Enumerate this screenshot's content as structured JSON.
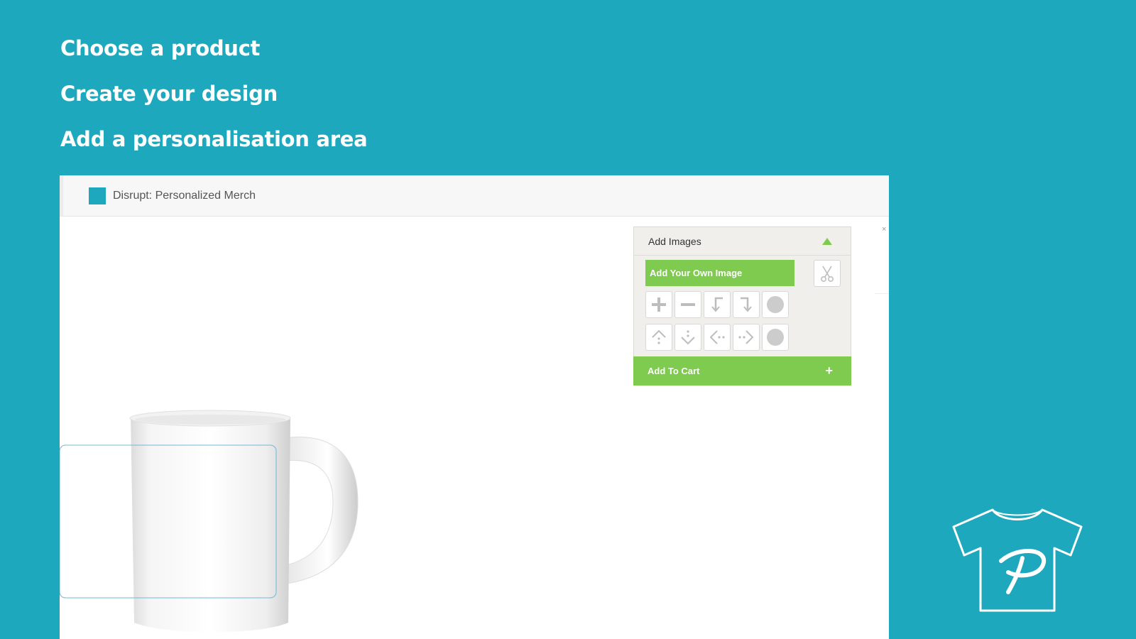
{
  "steps": [
    "Choose a product",
    "Create your design",
    "Add a personalisation area"
  ],
  "app": {
    "title": "Disrupt: Personalized Merch"
  },
  "panel": {
    "title": "Add Images",
    "add_image_label": "Add Your Own Image",
    "add_to_cart_label": "Add To Cart",
    "add_to_cart_icon": "+",
    "close_icon": "×",
    "tools_row1": [
      "plus-icon",
      "minus-icon",
      "bring-forward-icon",
      "send-backward-icon",
      "circle-icon"
    ],
    "tools_row2": [
      "move-up-icon",
      "move-down-icon",
      "move-left-icon",
      "move-right-icon",
      "circle-icon"
    ]
  },
  "colors": {
    "brand_teal": "#1ea8bd",
    "accent_green": "#7ecb4f"
  }
}
